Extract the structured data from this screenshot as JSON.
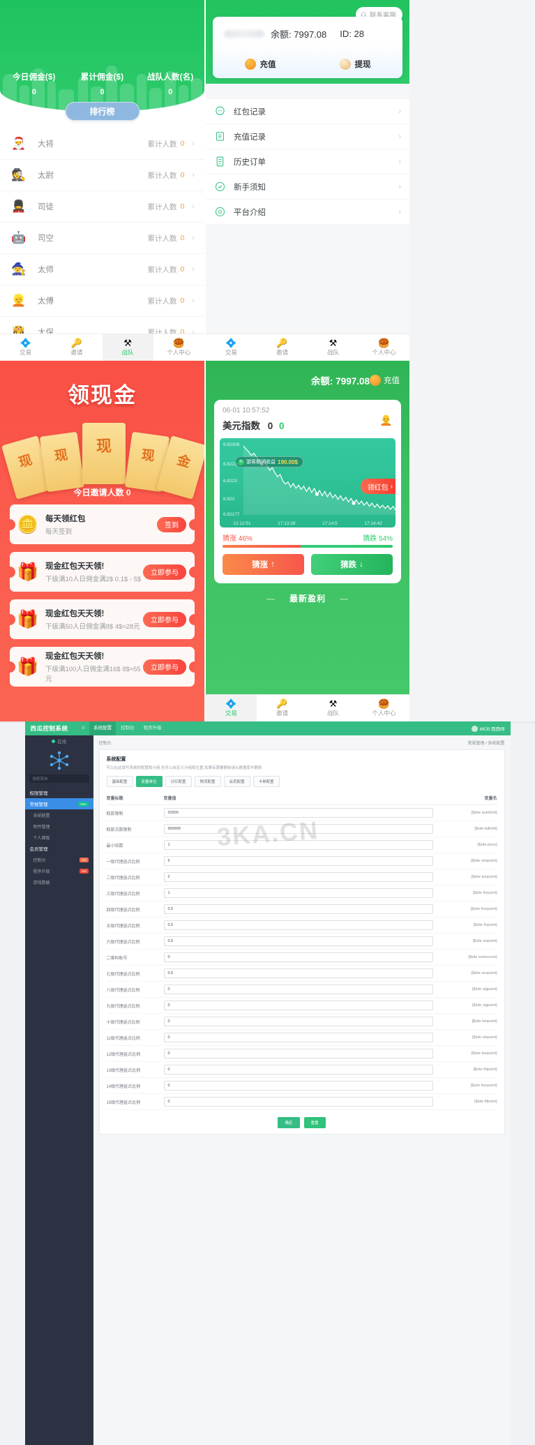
{
  "team_panel": {
    "stats": [
      {
        "label": "今日佣金($)",
        "value": "0"
      },
      {
        "label": "累计佣金($)",
        "value": "0"
      },
      {
        "label": "战队人数(名)",
        "value": "0"
      }
    ],
    "rank_button": "排行榜",
    "count_label": "累计人数",
    "ranks": [
      {
        "icon": "santa-avatar-icon",
        "glyph": "🎅",
        "name": "大将",
        "count": "0"
      },
      {
        "icon": "detective-avatar-icon",
        "glyph": "🕵",
        "name": "太尉",
        "count": "0"
      },
      {
        "icon": "guard-avatar-icon",
        "glyph": "💂",
        "name": "司徒",
        "count": "0"
      },
      {
        "icon": "robot-avatar-icon",
        "glyph": "🤖",
        "name": "司空",
        "count": "0"
      },
      {
        "icon": "mage-avatar-icon",
        "glyph": "🧙",
        "name": "太师",
        "count": "0"
      },
      {
        "icon": "person-avatar-icon",
        "glyph": "👱",
        "name": "太傅",
        "count": "0"
      },
      {
        "icon": "princess-avatar-icon",
        "glyph": "👸",
        "name": "太保",
        "count": "0"
      }
    ]
  },
  "wallet_panel": {
    "support_button": "联系客服",
    "balance_label": "余额:",
    "balance_value": "7997.08",
    "id_label": "ID:",
    "id_value": "28",
    "recharge": "充值",
    "withdraw": "提现",
    "menu": [
      {
        "icon": "chat-bubble-icon",
        "label": "红包记录"
      },
      {
        "icon": "book-icon",
        "label": "充值记录"
      },
      {
        "icon": "order-icon",
        "label": "历史订单"
      },
      {
        "icon": "check-circle-icon",
        "label": "新手须知"
      },
      {
        "icon": "gear-icon",
        "label": "平台介绍"
      }
    ]
  },
  "tabbar": {
    "items": [
      {
        "icon": "trade-icon",
        "glyph": "💠",
        "label": "交易"
      },
      {
        "icon": "invite-icon",
        "glyph": "🔑",
        "label": "邀请"
      },
      {
        "icon": "team-icon",
        "glyph": "⚒",
        "label": "战队"
      },
      {
        "icon": "profile-icon",
        "glyph": "🥮",
        "label": "个人中心"
      }
    ],
    "active_team": 2,
    "active_trade": 0
  },
  "cash_panel": {
    "title": "领现金",
    "ticket_char": "现",
    "ticket_char2": "金",
    "invite_today": "今日邀请人数 0",
    "cards": [
      {
        "icon": "gold-coin-icon",
        "glyph": "🪙",
        "title": "每天领红包",
        "sub": "每天签到",
        "button": "签到"
      },
      {
        "icon": "gift-box-icon",
        "glyph": "🎁",
        "title": "现金红包天天领!",
        "sub": "下级满10人日佣金满2$ 0.1$ - 5$",
        "button": "立即参与"
      },
      {
        "icon": "gift-box-icon",
        "glyph": "🎁",
        "title": "现金红包天天领!",
        "sub": "下级满50人日佣金满8$ 4$≈28元",
        "button": "立即参与"
      },
      {
        "icon": "gift-box-icon",
        "glyph": "🎁",
        "title": "现金红包天天领!",
        "sub": "下级满100人日佣金满16$ 8$≈55元",
        "button": "立即参与"
      }
    ]
  },
  "trade_panel": {
    "balance_label": "余额:",
    "balance_value": "7997.08",
    "recharge": "充值",
    "timestamp": "06-01 10:57:52",
    "symbol": "美元指数",
    "change1": "0",
    "change2": "0",
    "profit_pill": "游客期间收益",
    "profit_value": "190.00$",
    "redpack_float": "领红包",
    "up_label": "猜涨",
    "up_pct": "46%",
    "down_label": "猜跌",
    "down_pct": "54%",
    "btn_up": "猜涨",
    "btn_down": "猜跌",
    "latest": "最新盈利",
    "chart_data": {
      "type": "line",
      "title": "美元指数",
      "xlabel": "",
      "ylabel": "",
      "yticks": [
        "6.82306",
        "6.82226",
        "6.8223",
        "6.822",
        "6.82177"
      ],
      "xticks": [
        "12:12:51",
        "17:13:28",
        "17:14:5",
        "17:14:42"
      ],
      "ylim": [
        6.82177,
        6.82306
      ],
      "grid": false,
      "values": [
        6.82306,
        6.823,
        6.82295,
        6.82288,
        6.82292,
        6.82285,
        6.82278,
        6.82272,
        6.8228,
        6.82268,
        6.8226,
        6.82265,
        6.82255,
        6.82248,
        6.82252,
        6.8224,
        6.82234,
        6.82238,
        6.82228,
        6.82235,
        6.82226,
        6.82232,
        6.82224,
        6.8223,
        6.8222,
        6.82228,
        6.82218,
        6.82226,
        6.82215,
        6.82222,
        6.82212,
        6.8222,
        6.8221,
        6.82218,
        6.82208,
        6.82214,
        6.82205,
        6.82212,
        6.82203,
        6.82209,
        6.822,
        6.82207,
        6.82198,
        6.82204,
        6.82196,
        6.82202,
        6.82194,
        6.822,
        6.82192,
        6.82198,
        6.8219,
        6.82196,
        6.82189,
        6.82194,
        6.82188,
        6.82193,
        6.82186,
        6.82192,
        6.82185,
        6.8219
      ],
      "markers": [
        {
          "x": 0.12,
          "y": 6.8224
        },
        {
          "x": 0.48,
          "y": 6.82215
        },
        {
          "x": 0.72,
          "y": 6.82197
        }
      ]
    }
  },
  "admin_panel": {
    "logo": "西瓜控制系统",
    "top_tabs": [
      "0",
      "系统配置",
      "控制台",
      "程序升级"
    ],
    "active_top_tab": 1,
    "user": "MCB 西西呀",
    "side_status": "在线",
    "search_placeholder": "搜索菜单",
    "side_items": [
      {
        "label": "权限管理",
        "type": "grp",
        "badge": ""
      },
      {
        "label": "常规管理",
        "type": "act",
        "badge": "new"
      },
      {
        "label": "系统配置",
        "type": "sub",
        "badge": ""
      },
      {
        "label": "附件管理",
        "type": "sub",
        "badge": ""
      },
      {
        "label": "个人面板",
        "type": "sub",
        "badge": ""
      },
      {
        "label": "会员管理",
        "type": "grp",
        "badge": ""
      },
      {
        "label": "控制台",
        "type": "sub",
        "badge": "hot"
      },
      {
        "label": "程序升级",
        "type": "sub",
        "badge": "red"
      },
      {
        "label": "游戏数据",
        "type": "sub",
        "badge": ""
      }
    ],
    "breadcrumb_left": "控制台",
    "breadcrumb_right": "常规管理 / 系统配置",
    "card_title": "系统配置",
    "card_desc": "可以在此填写系统的配置和分组,也可以自定义分组和位置,如果有需要删除请从数据库中删除",
    "chips": [
      "基础配置",
      "变量单位",
      "分红配置",
      "物流配置",
      "会员配置",
      "卡券配置"
    ],
    "active_chip": 1,
    "columns": [
      "变量标题",
      "变量值",
      "变量名"
    ],
    "rows": [
      {
        "label": "取款限制",
        "value": "20000",
        "var": "[$site autolimit]"
      },
      {
        "label": "取款次数限制",
        "value": "999999",
        "var": "[$site bdlimit]"
      },
      {
        "label": "最小倍数",
        "value": "1",
        "var": "[$site price]"
      },
      {
        "label": "一级代理返点比例",
        "value": "5",
        "var": "[$site onepoint]"
      },
      {
        "label": "二级代理返点比例",
        "value": "2",
        "var": "[$site twopoint]"
      },
      {
        "label": "三级代理返点比例",
        "value": "1",
        "var": "[$site thrpoint]"
      },
      {
        "label": "四级代理返点比例",
        "value": "0.5",
        "var": "[$site fourpoint]"
      },
      {
        "label": "五级代理返点比例",
        "value": "0.5",
        "var": "[$site fivpoint]"
      },
      {
        "label": "六级代理返点比例",
        "value": "0.5",
        "var": "[$site sixpoint]"
      },
      {
        "label": "二维码账号",
        "value": "0",
        "var": "[$site ewmcount]"
      },
      {
        "label": "七级代理返点比例",
        "value": "0.5",
        "var": "[$site sevpoint]"
      },
      {
        "label": "八级代理返点比例",
        "value": "0",
        "var": "[$site eigpoint]"
      },
      {
        "label": "九级代理返点比例",
        "value": "0",
        "var": "[$site nigpoint]"
      },
      {
        "label": "十级代理返点比例",
        "value": "0",
        "var": "[$site tenpoint]"
      },
      {
        "label": "11级代理返点比例",
        "value": "0",
        "var": "[$site elepoint]"
      },
      {
        "label": "12级代理返点比例",
        "value": "0",
        "var": "[$site twepoint]"
      },
      {
        "label": "13级代理返点比例",
        "value": "0",
        "var": "[$site thipoint]"
      },
      {
        "label": "14级代理返点比例",
        "value": "0",
        "var": "[$site fourpoint]"
      },
      {
        "label": "15级代理返点比例",
        "value": "0",
        "var": "[$site fifpoint]"
      }
    ],
    "buttons": [
      "确定",
      "重置"
    ],
    "watermark": "3KA.CN"
  }
}
